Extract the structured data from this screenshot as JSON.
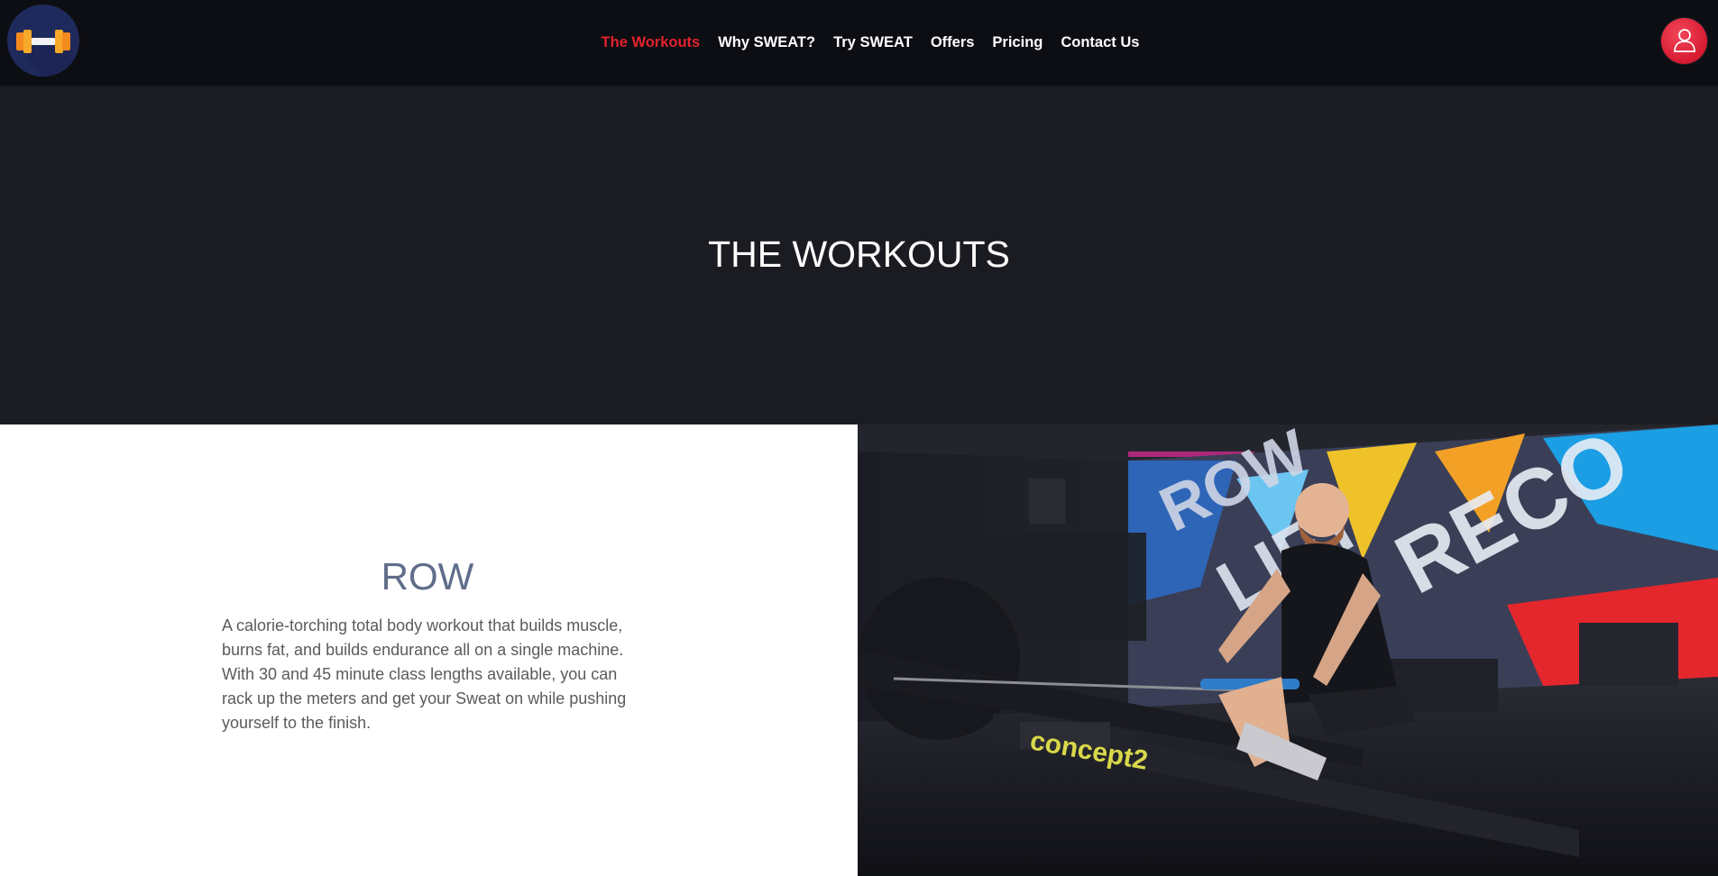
{
  "nav": {
    "logo_icon": "dumbbell-logo-icon",
    "items": [
      {
        "label": "The Workouts",
        "active": true
      },
      {
        "label": "Why SWEAT?",
        "active": false
      },
      {
        "label": "Try SWEAT",
        "active": false
      },
      {
        "label": "Offers",
        "active": false
      },
      {
        "label": "Pricing",
        "active": false
      },
      {
        "label": "Contact Us",
        "active": false
      }
    ],
    "user_icon": "user-icon",
    "accent_color": "#e3222d"
  },
  "hero": {
    "title": "THE WORKOUTS",
    "background": "#1b1c21"
  },
  "workout": {
    "title": "ROW",
    "description": "A calorie-torching total body workout that builds muscle, burns fat, and builds endurance all on a single machine. With 30 and 45 minute class lengths available, you can rack up the meters and get your Sweat on while pushing yourself to the finish.",
    "image_icon": "rowing-machine-photo"
  }
}
